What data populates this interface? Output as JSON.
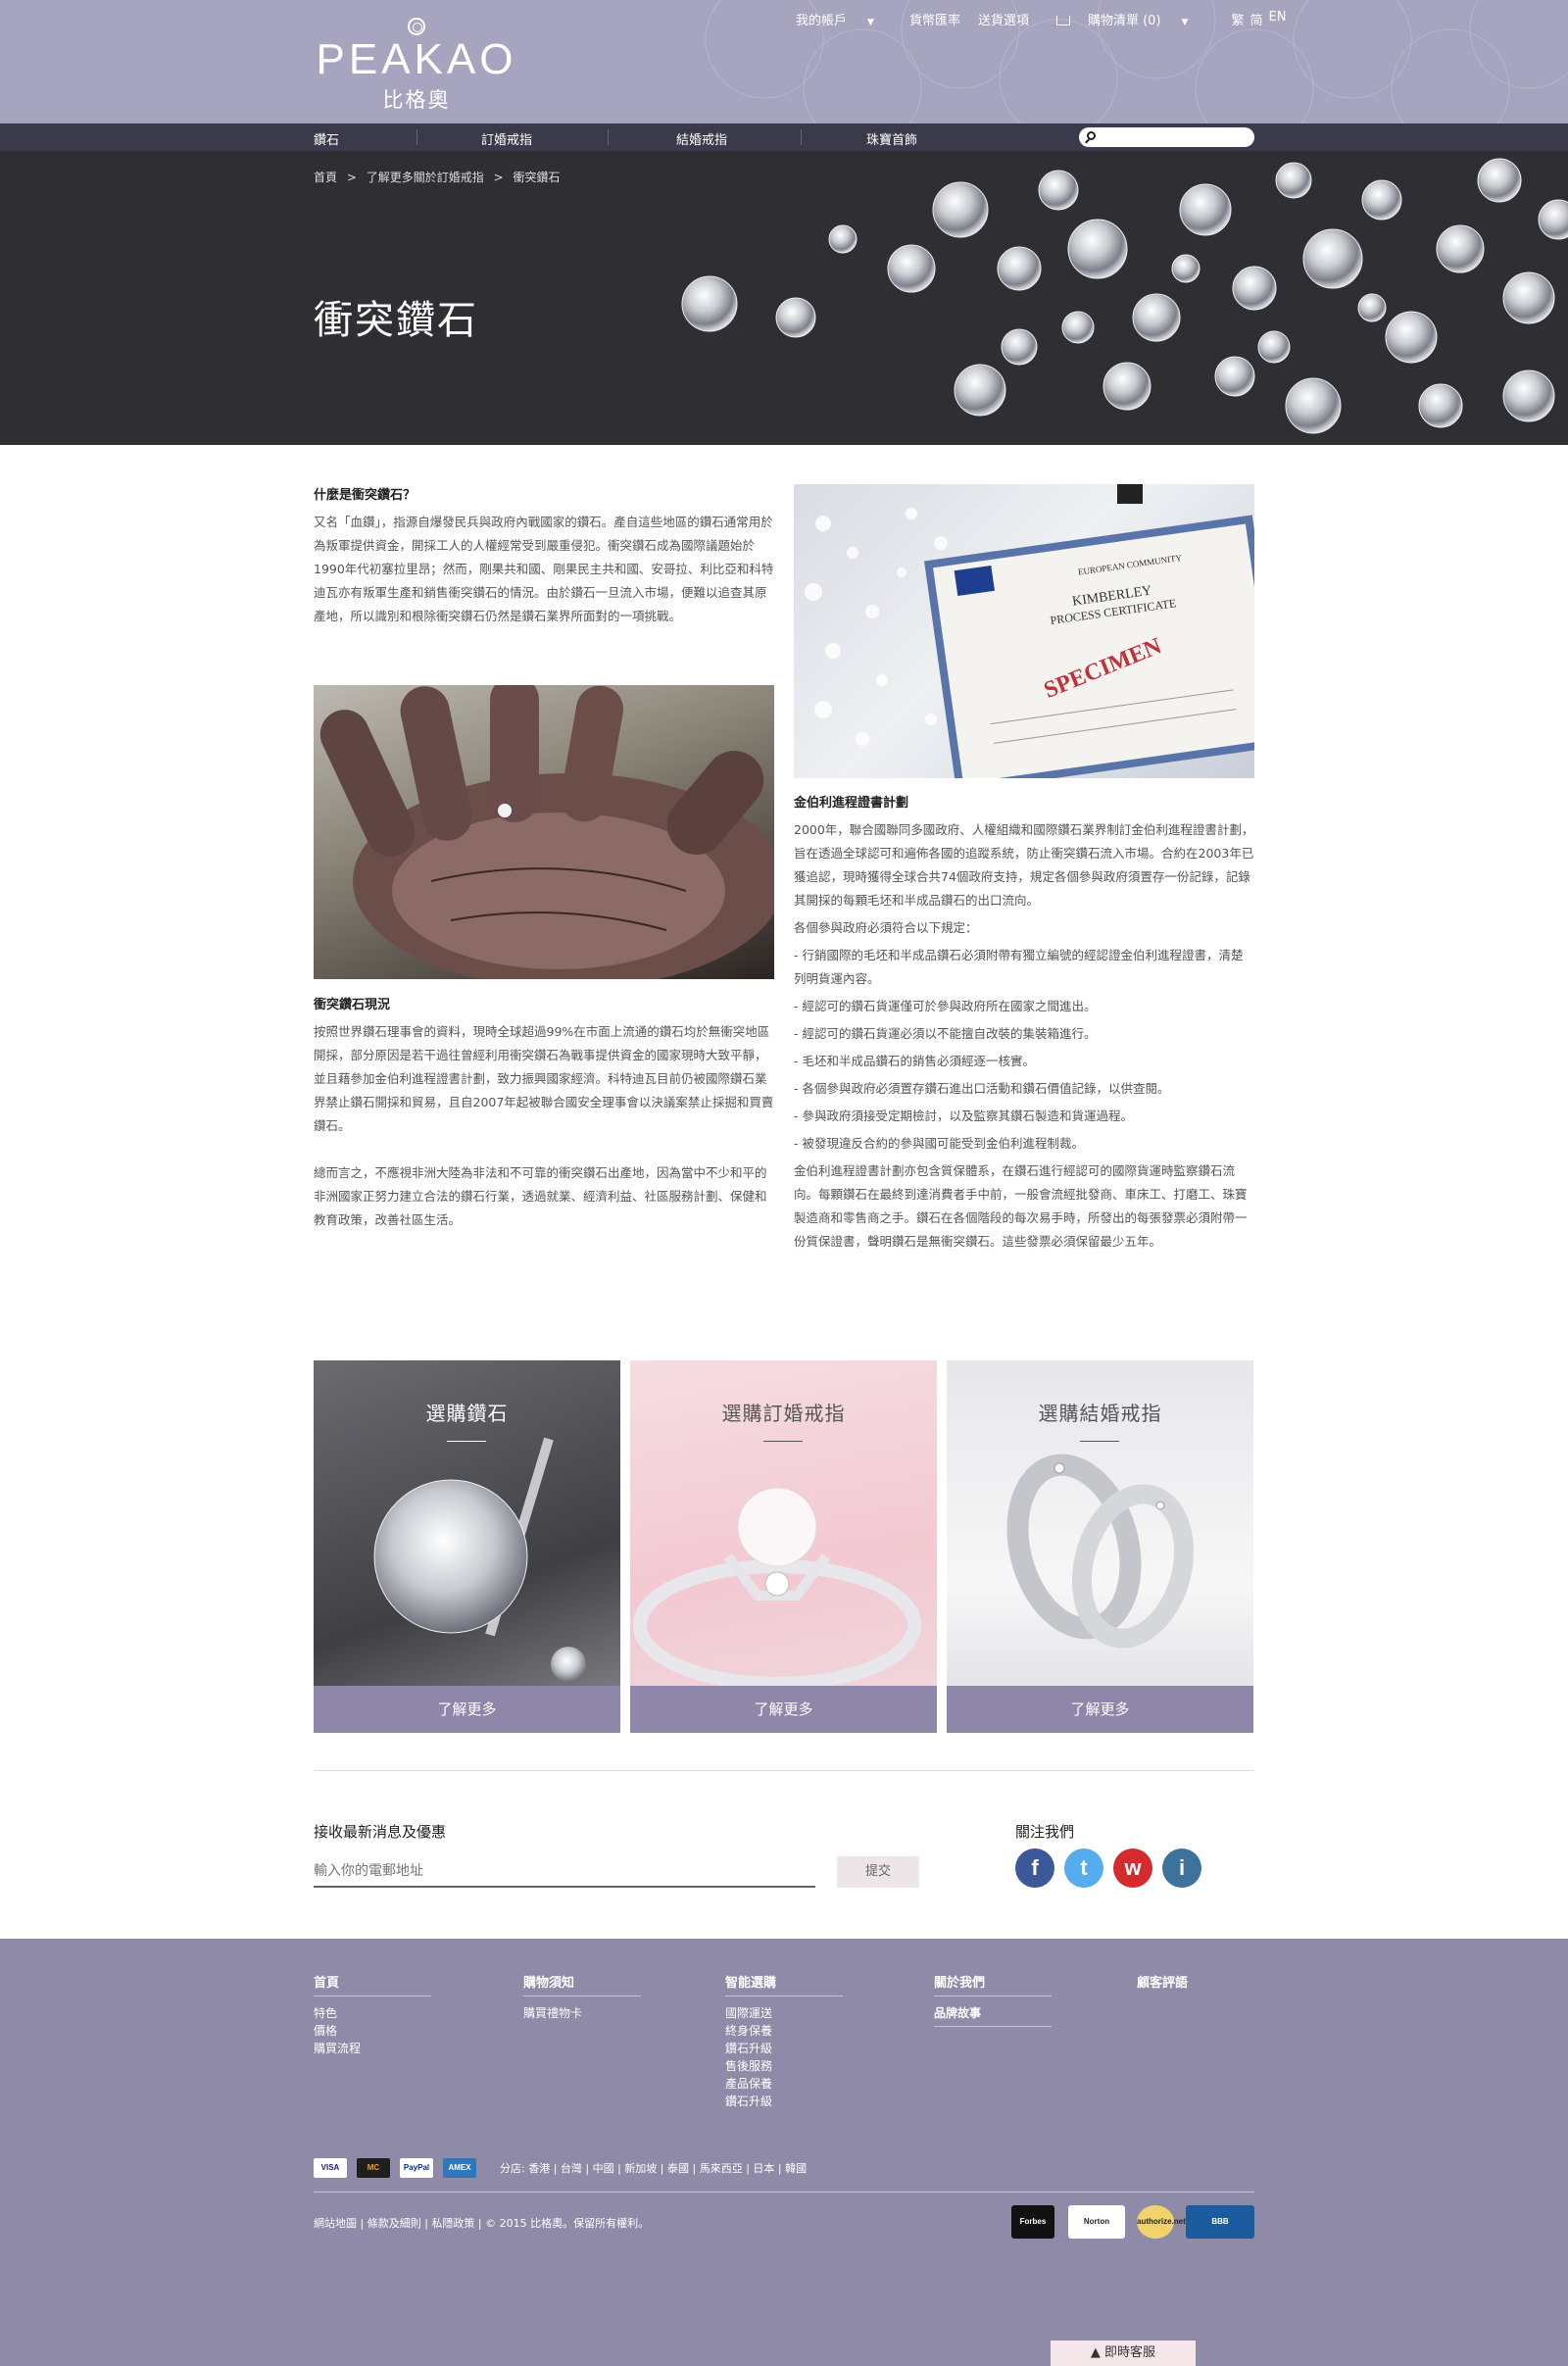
{
  "header": {
    "logo_text": "PEAKAO",
    "logo_sub": "比格奧",
    "topnav": {
      "account": "我的帳戶",
      "currency": "貨幣匯率",
      "shipping": "送貨選項",
      "cart": "購物清單 (0)",
      "lang_tc": "繁",
      "lang_sc": "简",
      "lang_en": "EN"
    }
  },
  "mainnav": {
    "items": [
      "鑽石",
      "訂婚戒指",
      "結婚戒指",
      "珠寶首飾"
    ],
    "search_placeholder": ""
  },
  "hero": {
    "breadcrumb": [
      "首頁",
      ">",
      "了解更多關於訂婚戒指",
      ">",
      "衝突鑽石"
    ],
    "title": "衝突鑽石"
  },
  "article": {
    "section1_title": "什麼是衝突鑽石？",
    "section1_body": "又名「血鑽」，指源自爆發民兵與政府內戰國家的鑽石。產自這些地區的鑽石通常用於為叛軍提供資金，開採工人的人權經常受到嚴重侵犯。衝突鑽石成為國際議題始於1990年代初塞拉里昂；然而，剛果共和國、剛果民主共和國、安哥拉、利比亞和科特迪瓦亦有叛軍生產和銷售衝突鑽石的情況。由於鑽石一旦流入市場，便難以追查其原產地，所以識別和根除衝突鑽石仍然是鑽石業界所面對的一項挑戰。",
    "section2_title": "衝突鑽石現況",
    "section2_body": "按照世界鑽石理事會的資料，現時全球超過99%在市面上流通的鑽石均於無衝突地區開採，部分原因是若干過往曾經利用衝突鑽石為戰事提供資金的國家現時大致平靜，並且藉參加金伯利進程證書計劃，致力振興國家經濟。科特迪瓦目前仍被國際鑽石業界禁止鑽石開採和貿易，且自2007年起被聯合國安全理事會以決議案禁止採掘和買賣鑽石。",
    "section2_body2": "總而言之，不應視非洲大陸為非法和不可靠的衝突鑽石出產地，因為當中不少和平的非洲國家正努力建立合法的鑽石行業，透過就業、經濟利益、社區服務計劃、保健和教育政策，改善社區生活。",
    "section3_title": "金伯利進程證書計劃",
    "section3_body": "2000年，聯合國聯同多國政府、人權組織和國際鑽石業界制訂金伯利進程證書計劃，旨在透過全球認可和遍佈各國的追蹤系統，防止衝突鑽石流入市場。合約在2003年已獲追認，現時獲得全球合共74個政府支持，規定各個參與政府須置存一份記錄，記錄其開採的每顆毛坯和半成品鑽石的出口流向。",
    "section3_intro": "各個參與政府必須符合以下規定：",
    "section3_rules": [
      "- 行銷國際的毛坯和半成品鑽石必須附帶有獨立編號的經認證金伯利進程證書，清楚列明貨運內容。",
      "- 經認可的鑽石貨運僅可於參與政府所在國家之間進出。",
      "- 經認可的鑽石貨運必須以不能擅自改裝的集裝箱進行。",
      "- 毛坯和半成品鑽石的銷售必須經逐一核實。",
      "- 各個參與政府必須置存鑽石進出口活動和鑽石價值記錄，以供查閱。",
      "- 參與政府須接受定期檢討，以及監察其鑽石製造和貨運過程。",
      "- 被發現違反合約的參與國可能受到金伯利進程制裁。"
    ],
    "section3_body2": "金伯利進程證書計劃亦包含質保體系，在鑽石進行經認可的國際貨運時監察鑽石流向。每顆鑽石在最終到達消費者手中前，一般會流經批發商、車床工、打磨工、珠寶製造商和零售商之手。鑽石在各個階段的每次易手時，所發出的每張發票必須附帶一份質保證書，聲明鑽石是無衝突鑽石。這些發票必須保留最少五年。"
  },
  "cert_image": {
    "line1": "EUROPEAN COMMUNITY",
    "line2": "KIMBERLEY",
    "line3": "PROCESS CERTIFICATE",
    "stamp": "SPECIMEN"
  },
  "cards": [
    {
      "title": "選購鑽石",
      "button": "了解更多"
    },
    {
      "title": "選購訂婚戒指",
      "button": "了解更多"
    },
    {
      "title": "選購結婚戒指",
      "button": "了解更多"
    }
  ],
  "newsletter": {
    "title": "接收最新消息及優惠",
    "placeholder": "輸入你的電郵地址",
    "submit": "提交",
    "follow_title": "關注我們"
  },
  "social": [
    "f",
    "t",
    "w",
    "i"
  ],
  "colors": {
    "header_bg": "#a7a4bf",
    "nav_bg": "#3a3a4a",
    "accent": "#8e87a9",
    "footer_bg": "#8e8aa7"
  },
  "footer": {
    "columns": [
      {
        "title": "首頁",
        "links": [
          "特色",
          "價格",
          "購買流程"
        ]
      },
      {
        "title": "購物須知",
        "links": [
          "購買禮物卡"
        ]
      },
      {
        "title": "智能選購",
        "links": [
          "國際運送",
          "終身保養",
          "鑽石升級",
          "售後服務",
          "產品保養",
          "鑽石升級"
        ]
      },
      {
        "title": "關於我們",
        "links": [
          "品牌故事"
        ]
      },
      {
        "title": "顧客評語",
        "links": []
      }
    ],
    "payments": [
      "VISA",
      "MC",
      "PayPal",
      "AMEX"
    ],
    "branches": "分店: 香港 | 台灣 | 中國 | 新加坡 | 泰國 | 馬來西亞 | 日本 | 韓國",
    "copyright": "網站地圖 | 條款及細則  | 私隱政策 | © 2015 比格奧。保留所有權利。",
    "badges": [
      "Forbes",
      "Norton",
      "authorize.net",
      "BBB"
    ],
    "chat": "▲  即時客服"
  }
}
